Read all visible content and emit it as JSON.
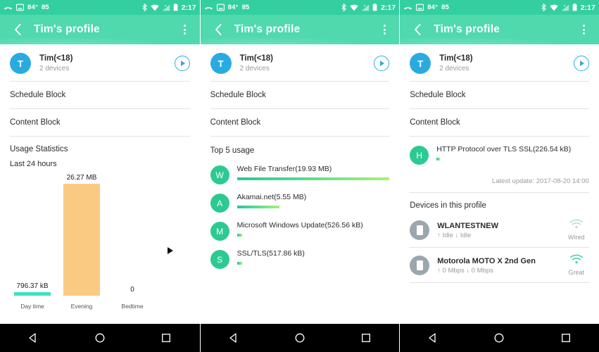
{
  "statusbar": {
    "temperature": "84°",
    "number": "85",
    "time": "2:17",
    "icons": [
      "call-ended-icon",
      "screenshot-icon",
      "bluetooth-icon",
      "wifi-icon",
      "signal-icon",
      "battery-icon"
    ]
  },
  "toolbar": {
    "title": "Tim's profile",
    "back_icon": "back-chevron-icon",
    "menu_icon": "overflow-menu-icon"
  },
  "profile": {
    "initial": "T",
    "name": "Tim(<18)",
    "devices": "2 devices",
    "play_icon": "play-icon",
    "accent": "#29ABE2"
  },
  "menu": {
    "schedule_block": "Schedule Block",
    "content_block": "Content Block"
  },
  "usage_section": {
    "title": "Usage Statistics",
    "subtitle": "Last 24 hours"
  },
  "chart_data": {
    "type": "bar",
    "title": "Usage Statistics",
    "subtitle": "Last 24 hours",
    "categories": [
      "Day time",
      "Evening",
      "Bedtime"
    ],
    "values": [
      0.796,
      26.27,
      0
    ],
    "value_labels": [
      "796.37 kB",
      "26.27 MB",
      "0"
    ],
    "unit": "MB",
    "colors": [
      "#3FE0C4",
      "#FBCA82",
      "#FBCA82"
    ],
    "xlabel": "",
    "ylabel": "",
    "ylim": [
      0,
      26.27
    ],
    "grid": false,
    "legend": "none"
  },
  "top5": {
    "title": "Top 5 usage",
    "items": [
      {
        "initial": "W",
        "label": "Web File Transfer(19.93 MB)",
        "bytes": 19930,
        "pct": 100
      },
      {
        "initial": "A",
        "label": "Akamai.net(5.55 MB)",
        "bytes": 5550,
        "pct": 27.8
      },
      {
        "initial": "M",
        "label": "Microsoft Windows Update(526.56 kB)",
        "bytes": 526.56,
        "pct": 3.6
      },
      {
        "initial": "S",
        "label": "SSL/TLS(517.86 kB)",
        "bytes": 517.86,
        "pct": 3.4
      },
      {
        "initial": "H",
        "label": "HTTP Protocol over TLS SSL(226.54 kB)",
        "bytes": 226.54,
        "pct": 2.0
      }
    ]
  },
  "latest_update": "Latest update: 2017-08-20 14:00",
  "devices_section": {
    "title": "Devices in this profile",
    "items": [
      {
        "name": "WLANTESTNEW",
        "rate": "↑ Idle  ↓ Idle",
        "signal_label": "Wired",
        "signal_color": "#B9D9CF"
      },
      {
        "name": "Motorola MOTO X 2nd Gen",
        "rate": "↑ 0 Mbps  ↓ 0 Mbps",
        "signal_label": "Great",
        "signal_color": "#3FD49D"
      }
    ]
  },
  "navbar": {
    "back": "nav-back-icon",
    "home": "nav-home-icon",
    "recents": "nav-recents-icon"
  },
  "theme": {
    "statusbar_bg": "#34CFA0",
    "toolbar_bg": "#4FD9AD",
    "accent_green": "#2CCA91",
    "bar_orange": "#FBCA82",
    "bar_teal": "#3FE0C4"
  }
}
